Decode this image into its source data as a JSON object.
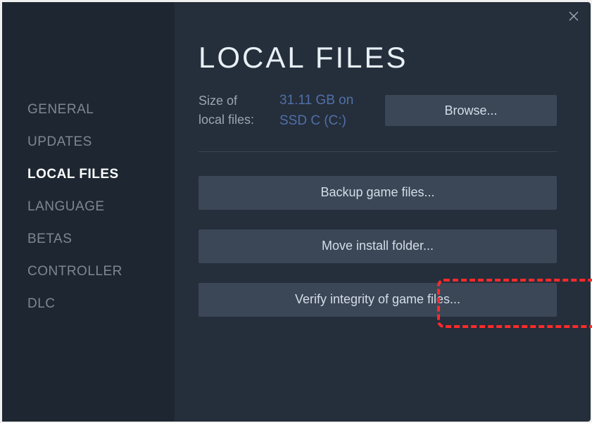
{
  "close_title": "Close",
  "sidebar": {
    "items": [
      {
        "label": "GENERAL",
        "active": false
      },
      {
        "label": "UPDATES",
        "active": false
      },
      {
        "label": "LOCAL FILES",
        "active": true
      },
      {
        "label": "LANGUAGE",
        "active": false
      },
      {
        "label": "BETAS",
        "active": false
      },
      {
        "label": "CONTROLLER",
        "active": false
      },
      {
        "label": "DLC",
        "active": false
      }
    ]
  },
  "page": {
    "title": "LOCAL FILES",
    "size_label": "Size of local files:",
    "size_value": "31.11 GB on SSD C (C:)",
    "browse_label": "Browse...",
    "backup_label": "Backup game files...",
    "move_label": "Move install folder...",
    "verify_label": "Verify integrity of game files..."
  }
}
